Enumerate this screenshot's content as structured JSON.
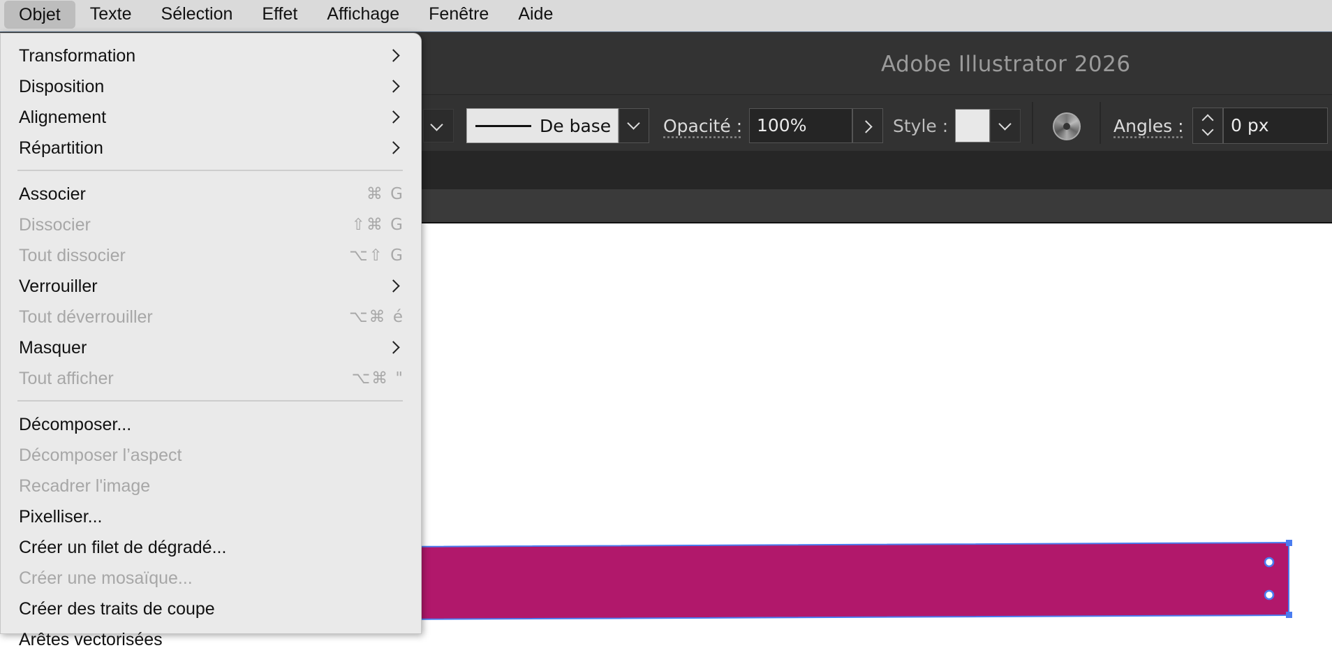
{
  "menubar": {
    "items": [
      "Objet",
      "Texte",
      "Sélection",
      "Effet",
      "Affichage",
      "Fenêtre",
      "Aide"
    ],
    "active": "Objet"
  },
  "app": {
    "title": "Adobe Illustrator 2026"
  },
  "control_bar": {
    "brush_label": "De base",
    "opacity_label": "Opacité :",
    "opacity_value": "100%",
    "style_label": "Style :",
    "angles_label": "Angles :",
    "angles_value": "0 px"
  },
  "dropdown": {
    "items": [
      {
        "label": "Transformation",
        "submenu": true,
        "enabled": true
      },
      {
        "label": "Disposition",
        "submenu": true,
        "enabled": true
      },
      {
        "label": "Alignement",
        "submenu": true,
        "enabled": true
      },
      {
        "label": "Répartition",
        "submenu": true,
        "enabled": true
      },
      {
        "label": "Associer",
        "shortcut": "⌘ G",
        "enabled": true
      },
      {
        "label": "Dissocier",
        "shortcut": "⇧⌘ G",
        "enabled": false
      },
      {
        "label": "Tout dissocier",
        "shortcut": "⌥⇧ G",
        "enabled": false
      },
      {
        "label": "Verrouiller",
        "submenu": true,
        "enabled": true
      },
      {
        "label": "Tout déverrouiller",
        "shortcut": "⌥⌘ é",
        "enabled": false
      },
      {
        "label": "Masquer",
        "submenu": true,
        "enabled": true
      },
      {
        "label": "Tout afficher",
        "shortcut": "⌥⌘ \"",
        "enabled": false
      },
      {
        "label": "Décomposer...",
        "enabled": true
      },
      {
        "label": "Décomposer l’aspect",
        "enabled": false
      },
      {
        "label": "Recadrer l'image",
        "enabled": false
      },
      {
        "label": "Pixelliser...",
        "enabled": true
      },
      {
        "label": "Créer un filet de dégradé...",
        "enabled": true
      },
      {
        "label": "Créer une mosaïque...",
        "enabled": false
      },
      {
        "label": "Créer des traits de coupe",
        "enabled": true
      },
      {
        "label": "Arêtes vectorisées",
        "enabled": true
      }
    ]
  },
  "canvas": {
    "shape_fill": "#b1186b",
    "selection_color": "#4a7cf0"
  }
}
